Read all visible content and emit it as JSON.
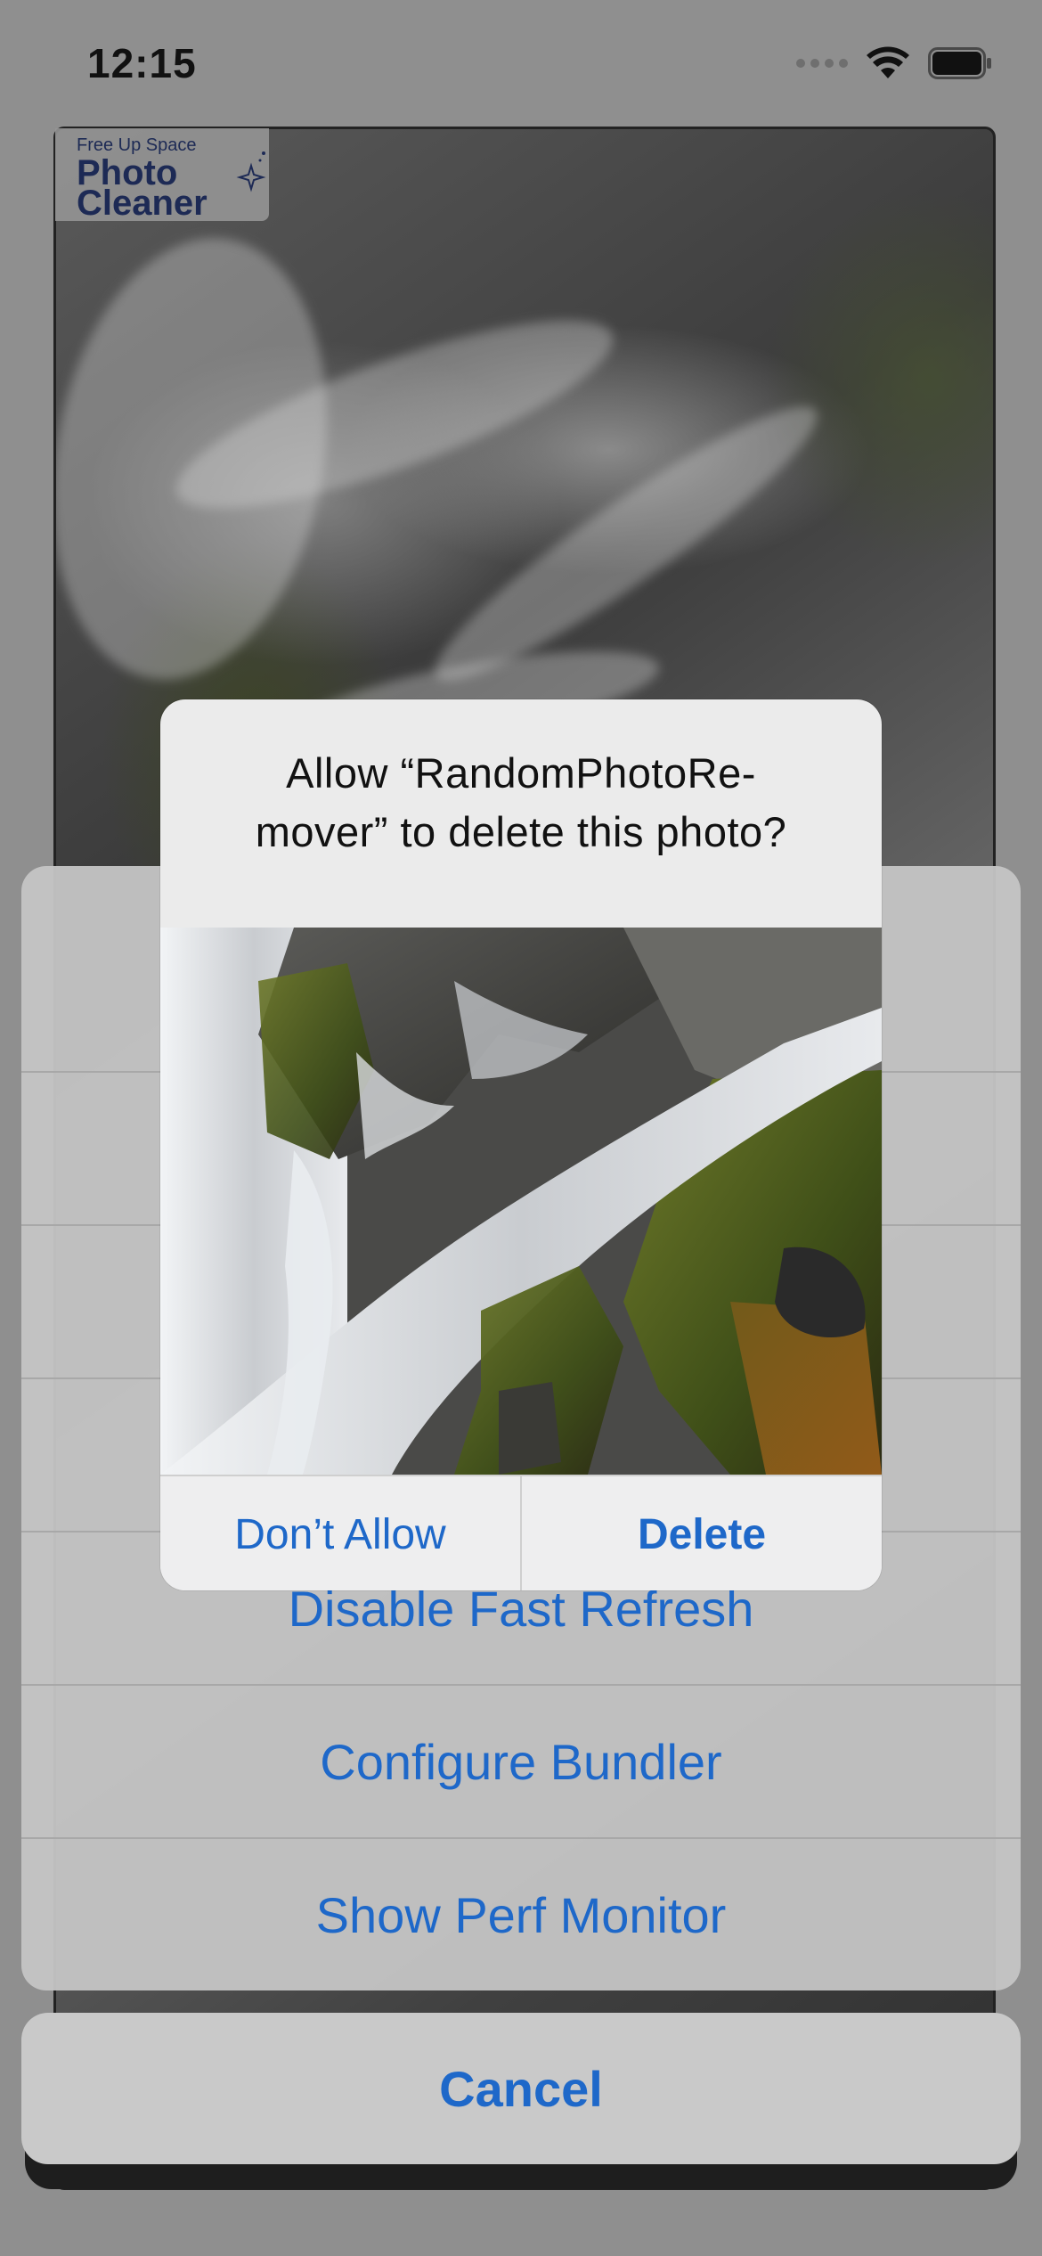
{
  "status_bar": {
    "time": "12:15",
    "icons": [
      "cellular-signal-icon",
      "wifi-icon",
      "battery-icon"
    ]
  },
  "app": {
    "logo": {
      "tagline": "Free Up Space",
      "line1": "Photo",
      "line2": "Cleaner"
    }
  },
  "action_sheet": {
    "items": [
      {
        "label": ""
      },
      {
        "label": ""
      },
      {
        "label": ""
      },
      {
        "label": ""
      },
      {
        "label": "Disable Fast Refresh"
      },
      {
        "label": "Configure Bundler"
      },
      {
        "label": "Show Perf Monitor"
      }
    ],
    "cancel_label": "Cancel"
  },
  "alert": {
    "title_line1": "Allow “RandomPhotoRe-",
    "title_line2": "mover” to delete this photo?",
    "dont_allow_label": "Don’t Allow",
    "delete_label": "Delete"
  },
  "colors": {
    "accent": "#1e68c9",
    "dim_background": "#8f8f8f",
    "sheet_background": "#c4c4c4",
    "alert_background": "#ebebeb"
  }
}
